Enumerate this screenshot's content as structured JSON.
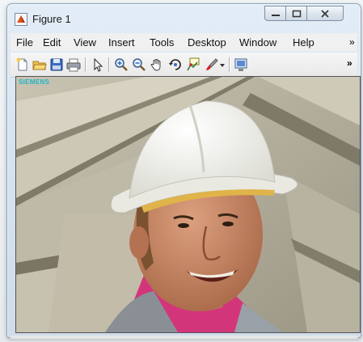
{
  "window": {
    "title": "Figure 1",
    "title_icon": "matlab-figure-icon",
    "controls": {
      "minimize_icon": "minimize-icon",
      "maximize_icon": "maximize-icon",
      "close_icon": "close-icon"
    }
  },
  "menubar": {
    "items": [
      {
        "label": "File"
      },
      {
        "label": "Edit"
      },
      {
        "label": "View"
      },
      {
        "label": "Insert"
      },
      {
        "label": "Tools"
      },
      {
        "label": "Desktop"
      },
      {
        "label": "Window"
      },
      {
        "label": "Help"
      }
    ],
    "overflow": "»"
  },
  "toolbar": {
    "buttons": [
      {
        "icon": "new-figure-icon"
      },
      {
        "icon": "open-file-icon"
      },
      {
        "icon": "save-icon"
      },
      {
        "icon": "print-icon"
      },
      {
        "icon": "edit-plot-arrow-icon"
      },
      {
        "icon": "zoom-in-icon"
      },
      {
        "icon": "zoom-out-icon"
      },
      {
        "icon": "pan-hand-icon"
      },
      {
        "icon": "rotate-3d-icon"
      },
      {
        "icon": "data-cursor-icon"
      },
      {
        "icon": "brush-icon"
      },
      {
        "icon": "brush-dropdown-icon"
      },
      {
        "icon": "link-plot-icon"
      }
    ],
    "overflow": "»"
  },
  "image": {
    "description_icon": "video-frame-image",
    "brand_text": "SIEMENS",
    "colors": {
      "helmet": "#f4f4ee",
      "skin": "#c88a6a",
      "concrete": "#b9b2a0",
      "shirt": "#d5357a"
    }
  }
}
